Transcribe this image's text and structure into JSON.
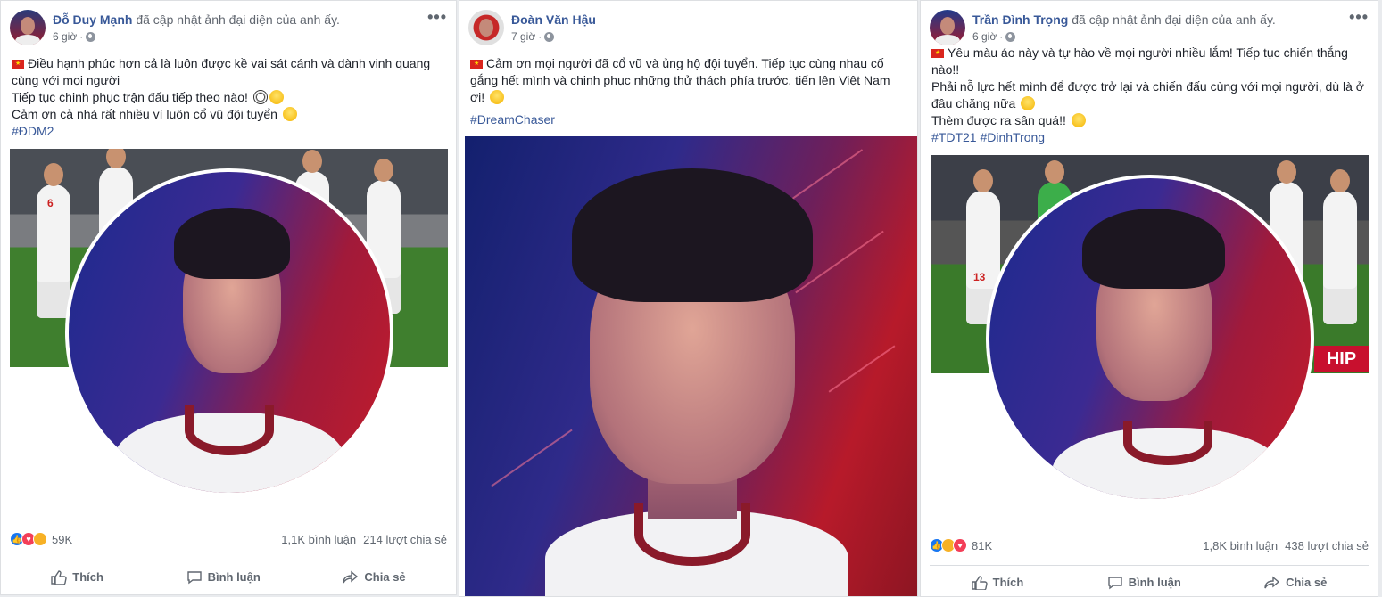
{
  "posts": [
    {
      "author": "Đỗ Duy Mạnh",
      "action": "đã cập nhật ảnh đại diện của anh ấy.",
      "time": "6 giờ",
      "lines": [
        "Điều hạnh phúc hơn cả là luôn được kề vai sát cánh và dành vinh quang cùng với mọi người",
        "Tiếp tục chinh phục trận đấu tiếp theo nào!",
        "Cảm ơn cả nhà rất nhiều vì luôn cổ vũ đội tuyển"
      ],
      "hashtag": "#ĐDM2",
      "reactions": "59K",
      "comments": "1,1K bình luận",
      "shares": "214 lượt chia sẻ",
      "jersey_number": "6"
    },
    {
      "author": "Đoàn Văn Hậu",
      "time": "7 giờ",
      "lines": [
        "Cảm ơn mọi người đã cổ vũ và ủng hộ đội tuyển. Tiếp tục cùng nhau cố gắng hết mình và chinh phục những thử thách phía trước, tiến lên Việt Nam ơi!"
      ],
      "hashtag": "#DreamChaser"
    },
    {
      "author": "Trần Đình Trọng",
      "action": "đã cập nhật ảnh đại diện của anh ấy.",
      "time": "6 giờ",
      "lines": [
        "Yêu màu áo này và tự hào về mọi người nhiều lắm! Tiếp tục chiến thắng nào!!",
        "Phải nỗ lực hết mình để được trở lại và chiến đấu cùng với mọi người, dù là ở đâu chăng nữa",
        "Thèm được ra sân quá!!"
      ],
      "hashtag": "#TDT21 #DinhTrong",
      "reactions": "81K",
      "comments": "1,8K bình luận",
      "shares": "438 lượt chia sẻ",
      "jersey_number": "13",
      "banner_text": "HIP"
    }
  ],
  "buttons": {
    "like": "Thích",
    "comment": "Bình luận",
    "share": "Chia sẻ"
  },
  "more_label": "•••"
}
